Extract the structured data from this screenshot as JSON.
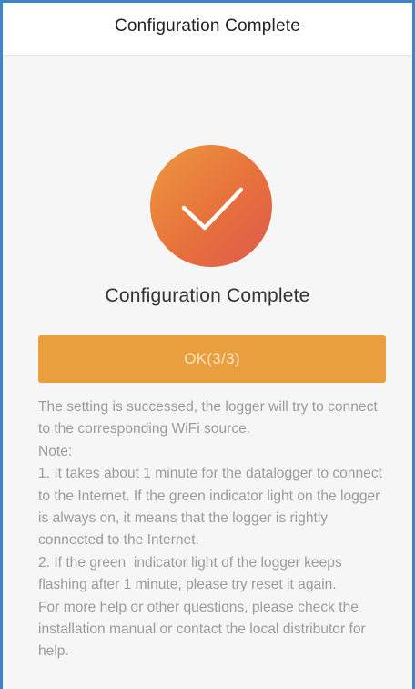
{
  "header": {
    "title": "Configuration Complete"
  },
  "result": {
    "icon": "check-icon",
    "title": "Configuration Complete",
    "circle_colors": [
      "#ec9a3c",
      "#e7713c",
      "#dd5a4a"
    ]
  },
  "ok_button": {
    "label": "OK(3/3)",
    "color": "#ea9f3e"
  },
  "note": {
    "lines": [
      "The setting is successed, the logger will try to connect to the corresponding WiFi source.",
      "Note:",
      "1. It takes about 1 minute for the datalogger to connect to the Internet. If the green indicator light on the logger is always on, it means that the logger is rightly connected to the Internet.",
      "2. If the green  indicator light of the logger keeps flashing after 1 minute, please try reset it again.",
      "For more help or other questions, please check the installation manual or contact the local distributor for help."
    ]
  },
  "theme": {
    "frame_border": "#3d86c9",
    "background": "#f6f6f6",
    "text_muted": "#9b9b9b"
  }
}
